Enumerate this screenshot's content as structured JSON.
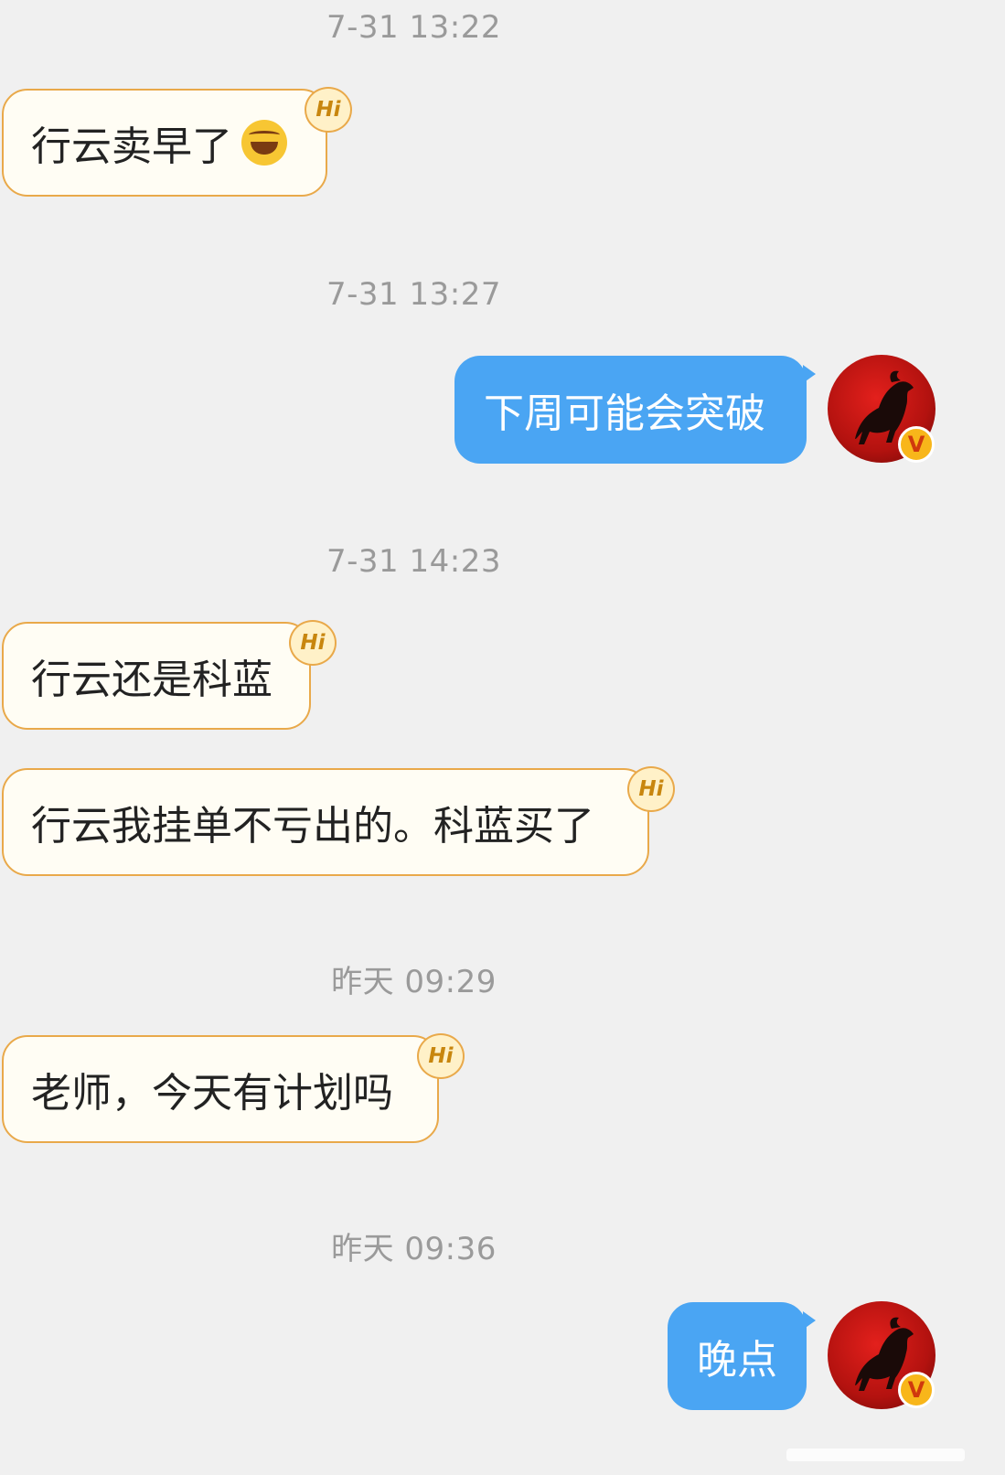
{
  "timestamps": [
    "7-31 13:22",
    "7-31 13:27",
    "7-31 14:23",
    "昨天 09:29",
    "昨天 09:36"
  ],
  "messages": {
    "m1": "行云卖早了",
    "m2": "下周可能会突破",
    "m3": "行云还是科蓝",
    "m4": "行云我挂单不亏出的。科蓝买了",
    "m5": "老师，今天有计划吗",
    "m6": "晚点"
  },
  "hi_badge": "Hi",
  "verified_badge": "V",
  "colors": {
    "background": "#f0f0f0",
    "incoming_bubble": "#fffdf4",
    "incoming_border": "#e9a94a",
    "outgoing_bubble": "#4aa5f3",
    "timestamp_text": "#9a9a9a"
  },
  "icons": {
    "emoji": "tears-of-joy-emoji-icon",
    "avatar": "horse-avatar",
    "hi": "hi-badge-icon",
    "verified": "verified-v-badge-icon"
  }
}
